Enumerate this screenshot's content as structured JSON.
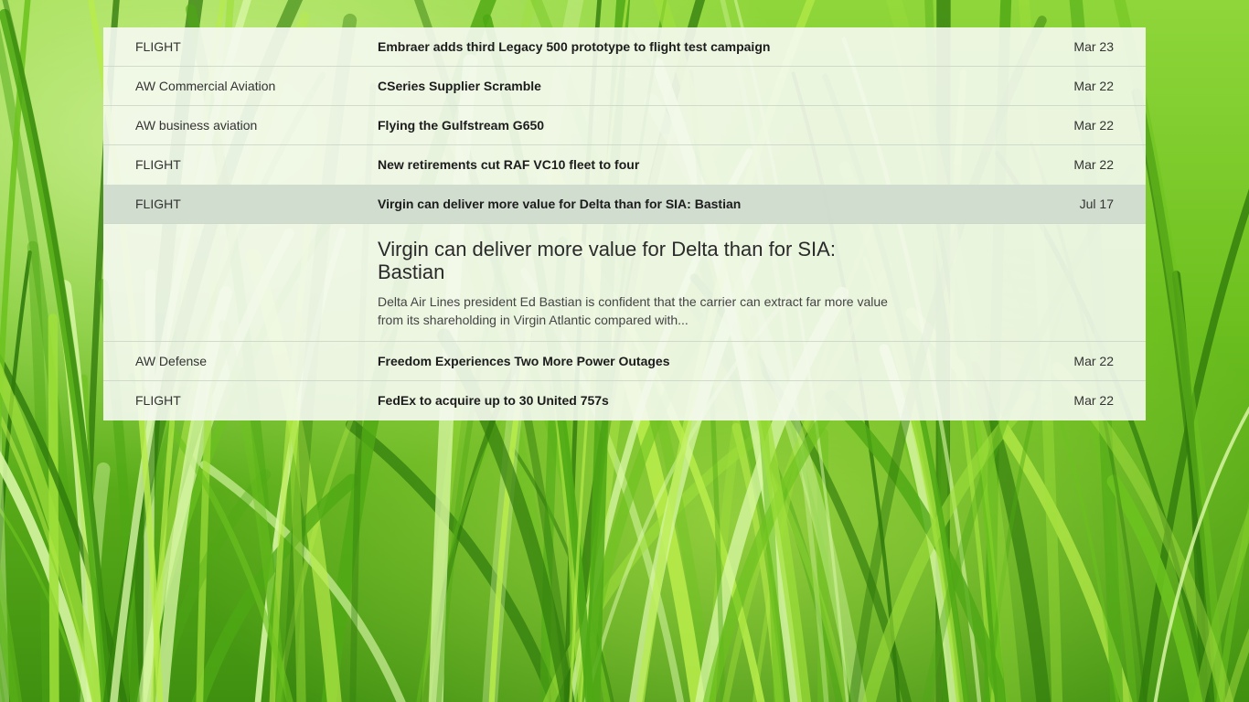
{
  "feed": {
    "items_before": [
      {
        "source": "FLIGHT",
        "title": "Embraer adds third Legacy 500 prototype to flight test campaign",
        "date": "Mar 23"
      },
      {
        "source": "AW Commercial Aviation",
        "title": "CSeries Supplier Scramble",
        "date": "Mar 22"
      },
      {
        "source": "AW business aviation",
        "title": "Flying the Gulfstream G650",
        "date": "Mar 22"
      },
      {
        "source": "FLIGHT",
        "title": "New retirements cut RAF VC10 fleet to four",
        "date": "Mar 22"
      }
    ],
    "selected": {
      "source": "FLIGHT",
      "title": "Virgin can deliver more value for Delta than for SIA: Bastian",
      "date": "Jul 17",
      "detail_title": "Virgin can deliver more value for Delta than for SIA: Bastian",
      "detail_summary": "Delta Air Lines president Ed Bastian is confident that the carrier can extract far more value from its shareholding in Virgin Atlantic compared with..."
    },
    "items_after": [
      {
        "source": "AW Defense",
        "title": "Freedom Experiences Two More Power Outages",
        "date": "Mar 22"
      },
      {
        "source": "FLIGHT",
        "title": "FedEx to acquire up to 30 United 757s",
        "date": "Mar 22"
      }
    ]
  },
  "background": {
    "subject": "green grass wallpaper",
    "colors": {
      "light": "#b8ec4a",
      "mid": "#6cc21e",
      "dark": "#2f7a0c"
    }
  }
}
